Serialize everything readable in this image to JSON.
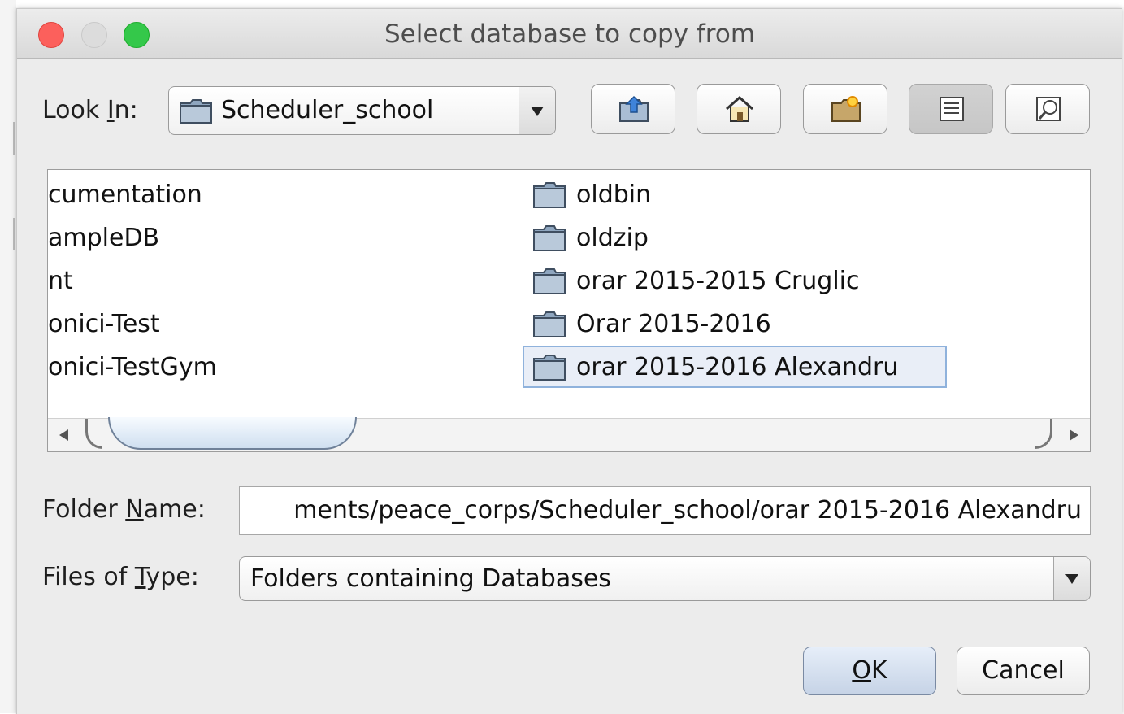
{
  "dialog": {
    "title": "Select database to copy from"
  },
  "look_in": {
    "label_pre": "Look ",
    "label_mnemonic": "I",
    "label_post": "n:",
    "value": "Scheduler_school"
  },
  "toolbar": {
    "buttons": [
      "up-one-level",
      "home",
      "create-new-folder",
      "list-view",
      "details-view"
    ],
    "pressed": "list-view"
  },
  "file_list": {
    "left_column": [
      "cumentation",
      "ampleDB",
      "nt",
      "onici-Test",
      "onici-TestGym"
    ],
    "right_column": [
      "oldbin",
      "oldzip",
      "orar 2015-2015 Cruglic",
      "Orar 2015-2016",
      "orar 2015-2016 Alexandru"
    ],
    "selected": "orar 2015-2016 Alexandru"
  },
  "folder_name": {
    "label_pre": "Folder ",
    "label_mnemonic": "N",
    "label_post": "ame:",
    "value": "ments/peace_corps/Scheduler_school/orar 2015-2016 Alexandru"
  },
  "files_of_type": {
    "label_pre": "Files of ",
    "label_mnemonic": "T",
    "label_post": "ype:",
    "value": "Folders containing Databases"
  },
  "buttons": {
    "ok_mnemonic": "O",
    "ok_rest": "K",
    "cancel": "Cancel"
  },
  "colors": {
    "close": "#fc605c",
    "minimize": "#dcdcdc",
    "zoom": "#34c84a",
    "selection_border": "#8fb2dc"
  }
}
